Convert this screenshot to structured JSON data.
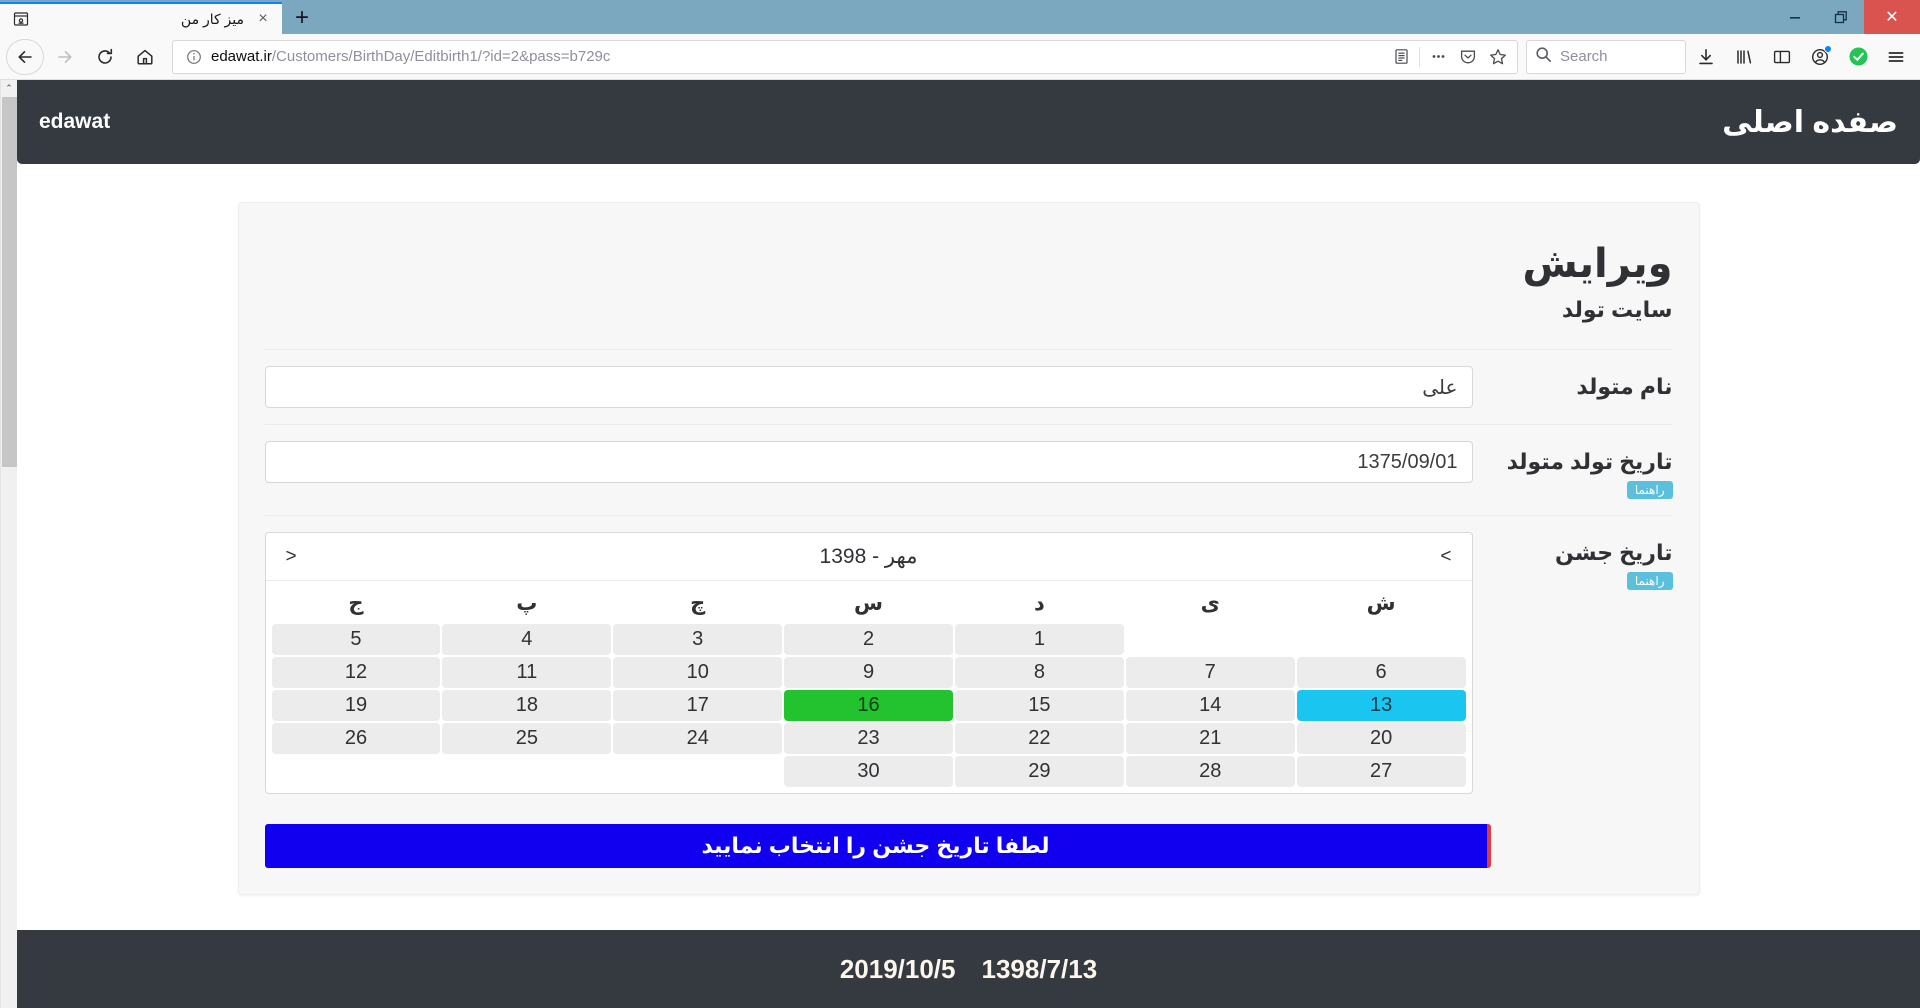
{
  "browser": {
    "tab": {
      "title": "میز کار من",
      "favicon_icon": "page-icon",
      "close_icon": "×"
    },
    "new_tab_label": "+",
    "window_controls": {
      "minimize": "–",
      "restore": "❐",
      "close": "✕"
    },
    "nav": {
      "back_icon": "back-arrow-icon",
      "forward_icon": "forward-arrow-icon",
      "reload_icon": "reload-icon",
      "home_icon": "home-icon"
    },
    "url": {
      "identity_icon": "info-icon",
      "domain": "edawat.ir",
      "path": "/Customers/BirthDay/Editbirth1/?id=2&pass=b729c",
      "reader_icon": "reader-view-icon",
      "more_icon": "page-actions-icon",
      "pocket_icon": "pocket-icon",
      "bookmark_icon": "star-icon"
    },
    "search": {
      "placeholder": "Search",
      "icon": "search-icon"
    },
    "toolbar": {
      "downloads_icon": "download-icon",
      "library_icon": "library-icon",
      "sidebar_icon": "sidebar-icon",
      "account_icon": "account-icon",
      "shield_icon": "green-check-icon",
      "menu_icon": "hamburger-menu-icon"
    },
    "scrollbar": {
      "up_arrow": "⌃"
    }
  },
  "site": {
    "navbar": {
      "right_link": "صفده اصلی",
      "brand": "edawat"
    },
    "card": {
      "title": "ویرایش",
      "subtitle": "سایت تولد"
    },
    "form": {
      "name_row": {
        "label": "نام متولد",
        "value": "علی"
      },
      "birthdate_row": {
        "label": "تاریخ تولد متولد",
        "value": "1375/09/01",
        "help": "راهنما"
      },
      "celebration_row": {
        "label": "تاریخ جشن",
        "help": "راهنما"
      }
    },
    "datepicker": {
      "prev": "<",
      "next": ">",
      "month_title": "مهر - 1398",
      "weekdays": [
        "ش",
        "ی",
        "د",
        "س",
        "چ",
        "پ",
        "ج"
      ],
      "weeks": [
        [
          "",
          "",
          "1",
          "2",
          "3",
          "4",
          "5"
        ],
        [
          "6",
          "7",
          "8",
          "9",
          "10",
          "11",
          "12"
        ],
        [
          "13",
          "14",
          "15",
          "16",
          "17",
          "18",
          "19"
        ],
        [
          "20",
          "21",
          "22",
          "23",
          "24",
          "25",
          "26"
        ],
        [
          "27",
          "28",
          "29",
          "30",
          "",
          "",
          ""
        ]
      ],
      "today": "13",
      "selected": "16",
      "today_color": "#1ac6f0",
      "selected_color": "#22c32e"
    },
    "alert": {
      "text": "لطفا تاریخ جشن را انتخاب نمایید",
      "bg_color": "#1100f0",
      "accent_color": "#e03b3b"
    },
    "footer": {
      "gregorian_date": "2019/10/5",
      "jalali_date": "1398/7/13"
    }
  }
}
